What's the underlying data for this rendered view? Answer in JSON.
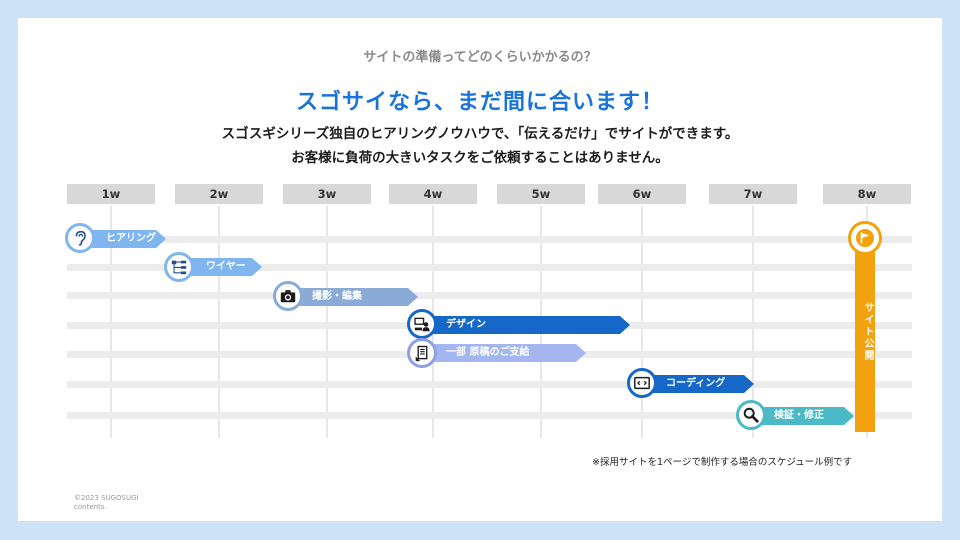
{
  "header": {
    "question": "サイトの準備ってどのくらいかかるの？",
    "headline": "スゴサイなら、まだ間に合います！",
    "description_line1": "スゴスギシリーズ独自のヒアリングノウハウで、「伝えるだけ」でサイトができます。",
    "description_line2": "お客様に負荷の大きいタスクをご依頼することはありません。"
  },
  "weeks": [
    "1w",
    "2w",
    "3w",
    "4w",
    "5w",
    "6w",
    "7w",
    "8w"
  ],
  "tasks": [
    {
      "label": "ヒアリング",
      "icon": "ear-icon",
      "color": "#7fb6ef",
      "circle_border": "#7fb6ef"
    },
    {
      "label": "ワイヤー",
      "icon": "sitemap-icon",
      "color": "#7fb6ef",
      "circle_border": "#7fb6ef"
    },
    {
      "label": "撮影・編集",
      "icon": "camera-icon",
      "color": "#8aabd6",
      "circle_border": "#8aabd6"
    },
    {
      "label": "デザイン",
      "icon": "designer-icon",
      "color": "#1568c8",
      "circle_border": "#1568c8"
    },
    {
      "label": "一部 原稿のご支給",
      "icon": "document-icon",
      "color": "#a3b6ef",
      "circle_border": "#8e9fe6"
    },
    {
      "label": "コーディング",
      "icon": "code-icon",
      "color": "#1568c8",
      "circle_border": "#1568c8"
    },
    {
      "label": "検証・修正",
      "icon": "magnifier-icon",
      "color": "#4bb9c6",
      "circle_border": "#4bb9c6"
    }
  ],
  "milestone": {
    "label": "サイト公開",
    "icon": "flag-icon",
    "color": "#f2a20f"
  },
  "footnote": "※採用サイトを1ページで制作する場合のスケジュール例です",
  "copyright_line1": "©2023 SUGOSUGI",
  "copyright_line2": "contents."
}
